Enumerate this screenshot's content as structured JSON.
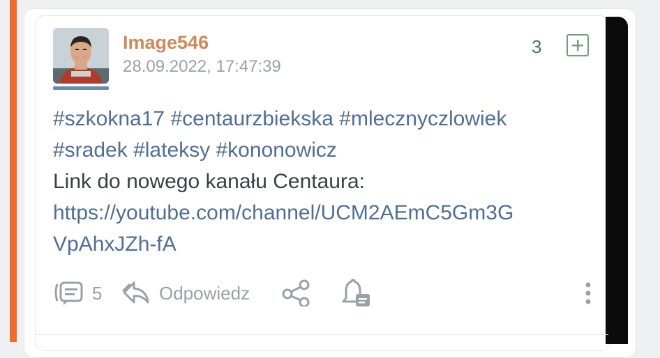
{
  "entry": {
    "username": "Image546",
    "timestamp": "28.09.2022, 17:47:39",
    "votes": "3",
    "tags_line1": [
      "#szkokna17",
      "#centaurzbiekska",
      "#mlecznyczlowiek"
    ],
    "tags_line2": [
      "#sradek",
      "#lateksy",
      "#kononowicz"
    ],
    "text": "Link do nowego kanału Centaura:",
    "link_line1": "https://youtube.com/channel/UCM2AEmC5Gm3G",
    "link_line2": "VpAhxJZh-fA"
  },
  "footer": {
    "comment_count": "5",
    "reply_label": "Odpowiedz"
  },
  "icons": {
    "plus": "plus-icon",
    "comments": "comments-icon",
    "reply": "reply-icon",
    "share": "share-icon",
    "notify": "bell-icon",
    "more": "more-vertical-icon"
  },
  "colors": {
    "accent": "#ef6c2c",
    "username": "#cf8a58",
    "tag": "#4e6f95",
    "vote": "#3f7d4f"
  }
}
